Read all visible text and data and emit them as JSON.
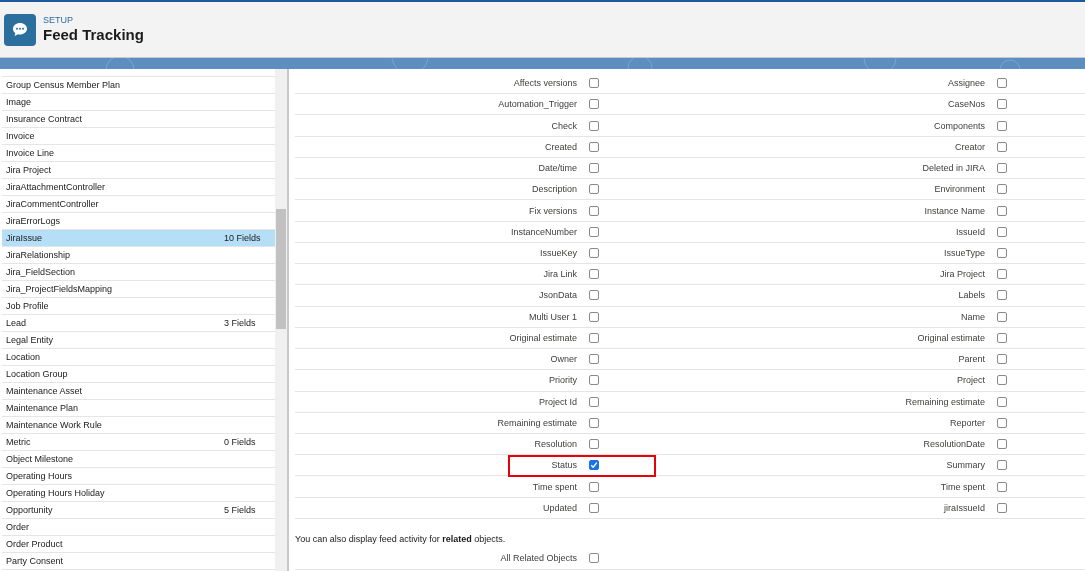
{
  "header": {
    "section": "SETUP",
    "title": "Feed Tracking"
  },
  "objects": [
    {
      "name": "Group Census Member Plan",
      "selected": false
    },
    {
      "name": "Image",
      "selected": false
    },
    {
      "name": "Insurance Contract",
      "selected": false
    },
    {
      "name": "Invoice",
      "selected": false
    },
    {
      "name": "Invoice Line",
      "selected": false
    },
    {
      "name": "Jira Project",
      "selected": false
    },
    {
      "name": "JiraAttachmentController",
      "selected": false
    },
    {
      "name": "JiraCommentController",
      "selected": false
    },
    {
      "name": "JiraErrorLogs",
      "selected": false
    },
    {
      "name": "JiraIssue",
      "fields": "10 Fields",
      "selected": true
    },
    {
      "name": "JiraRelationship",
      "selected": false
    },
    {
      "name": "Jira_FieldSection",
      "selected": false
    },
    {
      "name": "Jira_ProjectFieldsMapping",
      "selected": false
    },
    {
      "name": "Job Profile",
      "selected": false
    },
    {
      "name": "Lead",
      "fields": "3 Fields",
      "selected": false
    },
    {
      "name": "Legal Entity",
      "selected": false
    },
    {
      "name": "Location",
      "selected": false
    },
    {
      "name": "Location Group",
      "selected": false
    },
    {
      "name": "Maintenance Asset",
      "selected": false
    },
    {
      "name": "Maintenance Plan",
      "selected": false
    },
    {
      "name": "Maintenance Work Rule",
      "selected": false
    },
    {
      "name": "Metric",
      "fields": "0 Fields",
      "selected": false
    },
    {
      "name": "Object Milestone",
      "selected": false
    },
    {
      "name": "Operating Hours",
      "selected": false
    },
    {
      "name": "Operating Hours Holiday",
      "selected": false
    },
    {
      "name": "Opportunity",
      "fields": "5 Fields",
      "selected": false
    },
    {
      "name": "Order",
      "selected": false
    },
    {
      "name": "Order Product",
      "selected": false
    },
    {
      "name": "Party Consent",
      "selected": false
    }
  ],
  "fields": [
    {
      "left": {
        "label": "Affects versions",
        "checked": false,
        "highlighted": false
      },
      "right": {
        "label": "Assignee",
        "checked": false,
        "highlighted": false
      }
    },
    {
      "left": {
        "label": "Automation_Trigger",
        "checked": false,
        "highlighted": false
      },
      "right": {
        "label": "CaseNos",
        "checked": false,
        "highlighted": false
      }
    },
    {
      "left": {
        "label": "Check",
        "checked": false,
        "highlighted": false
      },
      "right": {
        "label": "Components",
        "checked": false,
        "highlighted": false
      }
    },
    {
      "left": {
        "label": "Created",
        "checked": false,
        "highlighted": false
      },
      "right": {
        "label": "Creator",
        "checked": false,
        "highlighted": false
      }
    },
    {
      "left": {
        "label": "Date/time",
        "checked": false,
        "highlighted": false
      },
      "right": {
        "label": "Deleted in JIRA",
        "checked": false,
        "highlighted": false
      }
    },
    {
      "left": {
        "label": "Description",
        "checked": false,
        "highlighted": false
      },
      "right": {
        "label": "Environment",
        "checked": false,
        "highlighted": false
      }
    },
    {
      "left": {
        "label": "Fix versions",
        "checked": false,
        "highlighted": false
      },
      "right": {
        "label": "Instance Name",
        "checked": false,
        "highlighted": false
      }
    },
    {
      "left": {
        "label": "InstanceNumber",
        "checked": false,
        "highlighted": false
      },
      "right": {
        "label": "IssueId",
        "checked": false,
        "highlighted": false
      }
    },
    {
      "left": {
        "label": "IssueKey",
        "checked": false,
        "highlighted": false
      },
      "right": {
        "label": "IssueType",
        "checked": false,
        "highlighted": false
      }
    },
    {
      "left": {
        "label": "Jira Link",
        "checked": false,
        "highlighted": false
      },
      "right": {
        "label": "Jira Project",
        "checked": false,
        "highlighted": false
      }
    },
    {
      "left": {
        "label": "JsonData",
        "checked": false,
        "highlighted": false
      },
      "right": {
        "label": "Labels",
        "checked": false,
        "highlighted": false
      }
    },
    {
      "left": {
        "label": "Multi User 1",
        "checked": false,
        "highlighted": false
      },
      "right": {
        "label": "Name",
        "checked": false,
        "highlighted": false
      }
    },
    {
      "left": {
        "label": "Original estimate",
        "checked": false,
        "highlighted": false
      },
      "right": {
        "label": "Original estimate",
        "checked": false,
        "highlighted": false
      }
    },
    {
      "left": {
        "label": "Owner",
        "checked": false,
        "highlighted": false
      },
      "right": {
        "label": "Parent",
        "checked": false,
        "highlighted": false
      }
    },
    {
      "left": {
        "label": "Priority",
        "checked": false,
        "highlighted": false
      },
      "right": {
        "label": "Project",
        "checked": false,
        "highlighted": false
      }
    },
    {
      "left": {
        "label": "Project Id",
        "checked": false,
        "highlighted": false
      },
      "right": {
        "label": "Remaining estimate",
        "checked": false,
        "highlighted": false
      }
    },
    {
      "left": {
        "label": "Remaining estimate",
        "checked": false,
        "highlighted": false
      },
      "right": {
        "label": "Reporter",
        "checked": false,
        "highlighted": false
      }
    },
    {
      "left": {
        "label": "Resolution",
        "checked": false,
        "highlighted": false
      },
      "right": {
        "label": "ResolutionDate",
        "checked": false,
        "highlighted": false
      }
    },
    {
      "left": {
        "label": "Status",
        "checked": true,
        "highlighted": true
      },
      "right": {
        "label": "Summary",
        "checked": false,
        "highlighted": false
      }
    },
    {
      "left": {
        "label": "Time spent",
        "checked": false,
        "highlighted": false
      },
      "right": {
        "label": "Time spent",
        "checked": false,
        "highlighted": false
      }
    },
    {
      "left": {
        "label": "Updated",
        "checked": false,
        "highlighted": false
      },
      "right": {
        "label": "jiraIssueId",
        "checked": false,
        "highlighted": false
      }
    }
  ],
  "related": {
    "note": "You can also display feed activity for **related** objects.",
    "option": {
      "label": "All Related Objects",
      "checked": false
    }
  }
}
